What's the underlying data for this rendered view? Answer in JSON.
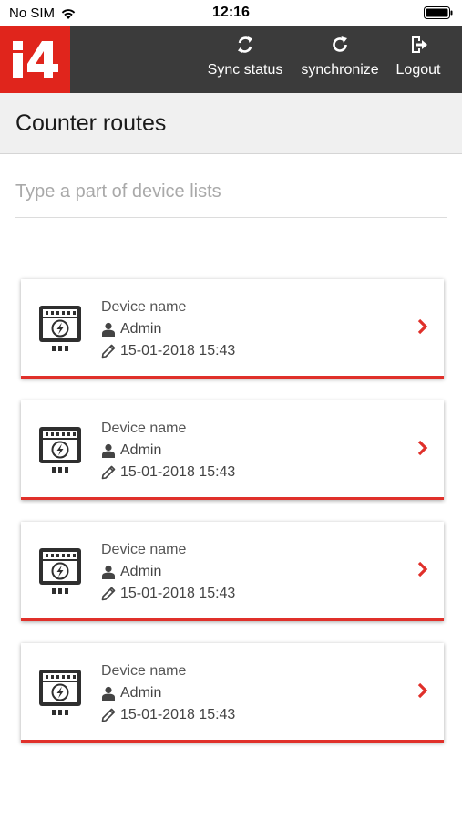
{
  "status_bar": {
    "carrier": "No SIM",
    "time": "12:16"
  },
  "nav": {
    "logo_text": "i4",
    "sync_status": "Sync status",
    "synchronize": "synchronize",
    "logout": "Logout"
  },
  "page": {
    "title": "Counter routes"
  },
  "search": {
    "placeholder": "Type a part of device lists"
  },
  "colors": {
    "brand_red": "#e0251c",
    "topbar": "#3b3b3b",
    "accent_line": "#e0302a"
  },
  "cards": [
    {
      "name": "Device name",
      "user": "Admin",
      "date": "15-01-2018 15:43"
    },
    {
      "name": "Device name",
      "user": "Admin",
      "date": "15-01-2018 15:43"
    },
    {
      "name": "Device name",
      "user": "Admin",
      "date": "15-01-2018 15:43"
    },
    {
      "name": "Device name",
      "user": "Admin",
      "date": "15-01-2018 15:43"
    }
  ]
}
